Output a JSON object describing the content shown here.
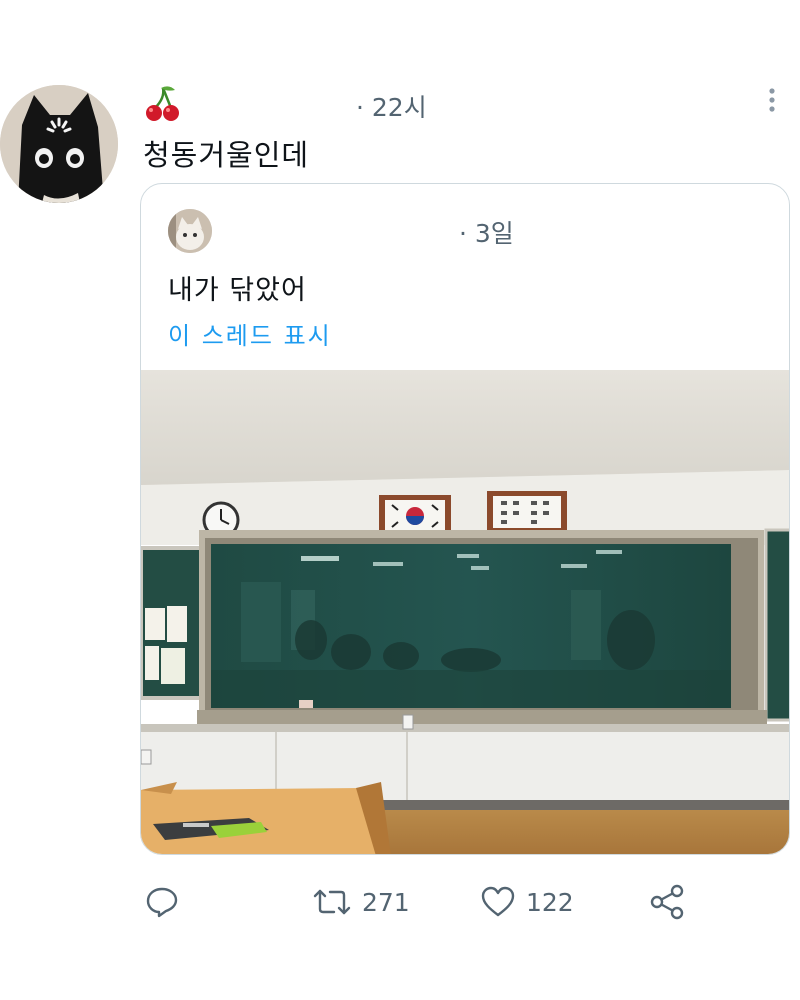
{
  "tweet": {
    "display_name_emoji": "cherries",
    "time": "· 22시",
    "text": "청동거울인데",
    "avatar": "black-cat-avatar"
  },
  "quote": {
    "time": "· 3일",
    "text": "내가 닦았어",
    "show_thread_label": "이 스레드 표시",
    "image": "classroom-blackboard-photo"
  },
  "actions": {
    "reply_icon": "reply-icon",
    "retweet_icon": "retweet-icon",
    "retweet_count": "271",
    "like_icon": "heart-icon",
    "like_count": "122",
    "share_icon": "share-icon"
  },
  "colors": {
    "link": "#1d9bf0",
    "secondary_text": "#536471",
    "border": "#cfd9de"
  }
}
